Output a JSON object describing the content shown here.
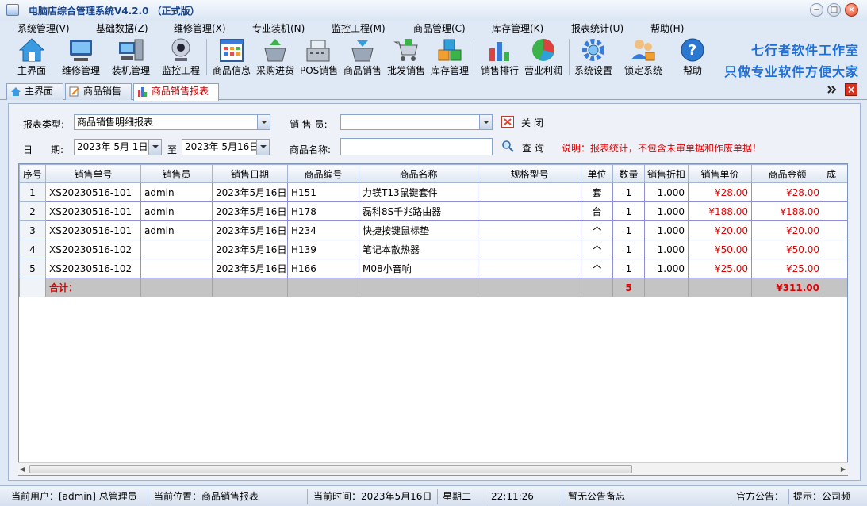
{
  "window": {
    "title": "电脑店综合管理系统V4.2.0 （正式版）"
  },
  "menu": [
    "系统管理(V)",
    "基础数据(Z)",
    "维修管理(X)",
    "专业装机(N)",
    "监控工程(M)",
    "商品管理(C)",
    "库存管理(K)",
    "报表统计(U)",
    "帮助(H)"
  ],
  "toolbar": [
    {
      "label": "主界面",
      "icon": "home-icon"
    },
    {
      "label": "维修管理",
      "icon": "monitor-icon"
    },
    {
      "label": "装机管理",
      "icon": "computer-icon"
    },
    {
      "label": "监控工程",
      "icon": "camera-icon"
    },
    {
      "label": "商品信息",
      "icon": "calendar-grid-icon"
    },
    {
      "label": "采购进货",
      "icon": "basket-in-icon"
    },
    {
      "label": "POS销售",
      "icon": "cash-register-icon"
    },
    {
      "label": "商品销售",
      "icon": "basket-out-icon"
    },
    {
      "label": "批发销售",
      "icon": "cart-icon"
    },
    {
      "label": "库存管理",
      "icon": "boxes-icon"
    },
    {
      "label": "销售排行",
      "icon": "bar-chart-icon"
    },
    {
      "label": "营业利润",
      "icon": "pie-chart-icon"
    },
    {
      "label": "系统设置",
      "icon": "gear-icon"
    },
    {
      "label": "锁定系统",
      "icon": "users-lock-icon"
    },
    {
      "label": "帮助",
      "icon": "help-icon"
    }
  ],
  "slogan": {
    "line1": "七行者软件工作室",
    "line2": "只做专业软件方便大家"
  },
  "tabs": [
    {
      "label": "主界面",
      "icon": "home-icon"
    },
    {
      "label": "商品销售",
      "icon": "edit-doc-icon"
    },
    {
      "label": "商品销售报表",
      "icon": "bar-chart-icon"
    }
  ],
  "filters": {
    "report_type_label": "报表类型:",
    "report_type_value": "商品销售明细报表",
    "salesperson_label": "销 售 员:",
    "salesperson_value": "",
    "close_label": "关 闭",
    "date_label_1": "日",
    "date_label_2": "期:",
    "date_from": "2023年 5月 1日",
    "date_to_label": "至",
    "date_to": "2023年 5月16日",
    "product_name_label": "商品名称:",
    "product_name_value": "",
    "query_label": "查 询",
    "notice": "说明：报表统计，不包含未审单据和作废单据！"
  },
  "table": {
    "columns": [
      "序号",
      "销售单号",
      "销售员",
      "销售日期",
      "商品编号",
      "商品名称",
      "规格型号",
      "单位",
      "数量",
      "销售折扣",
      "销售单价",
      "商品金额",
      "成"
    ],
    "rows": [
      {
        "seq": "1",
        "order_no": "XS20230516-101",
        "salesperson": "admin",
        "date": "2023年5月16日",
        "code": "H151",
        "name": "力镁T13鼠键套件",
        "spec": "",
        "unit": "套",
        "qty": "1",
        "discount": "1.000",
        "price": "¥28.00",
        "amount": "¥28.00"
      },
      {
        "seq": "2",
        "order_no": "XS20230516-101",
        "salesperson": "admin",
        "date": "2023年5月16日",
        "code": "H178",
        "name": "磊科8S千兆路由器",
        "spec": "",
        "unit": "台",
        "qty": "1",
        "discount": "1.000",
        "price": "¥188.00",
        "amount": "¥188.00"
      },
      {
        "seq": "3",
        "order_no": "XS20230516-101",
        "salesperson": "admin",
        "date": "2023年5月16日",
        "code": "H234",
        "name": "快捷按键鼠标垫",
        "spec": "",
        "unit": "个",
        "qty": "1",
        "discount": "1.000",
        "price": "¥20.00",
        "amount": "¥20.00"
      },
      {
        "seq": "4",
        "order_no": "XS20230516-102",
        "salesperson": "",
        "date": "2023年5月16日",
        "code": "H139",
        "name": "笔记本散热器",
        "spec": "",
        "unit": "个",
        "qty": "1",
        "discount": "1.000",
        "price": "¥50.00",
        "amount": "¥50.00"
      },
      {
        "seq": "5",
        "order_no": "XS20230516-102",
        "salesperson": "",
        "date": "2023年5月16日",
        "code": "H166",
        "name": "M08小音响",
        "spec": "",
        "unit": "个",
        "qty": "1",
        "discount": "1.000",
        "price": "¥25.00",
        "amount": "¥25.00"
      }
    ],
    "summary": {
      "label": "合计：",
      "qty": "5",
      "amount": "¥311.00"
    }
  },
  "status": {
    "user": "当前用户：[admin] 总管理员",
    "location": "当前位置：商品销售报表",
    "time_label": "当前时间：2023年5月16日",
    "weekday": "星期二",
    "clock": "22:11:26",
    "memo": "暂无公告备忘",
    "official": "官方公告：",
    "tip": "提示：公司频"
  },
  "colors": {
    "accent": "#1e6fd9",
    "alert": "#e00000",
    "title": "#15428b"
  }
}
